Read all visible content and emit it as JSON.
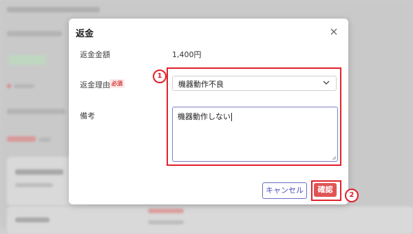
{
  "dialog": {
    "title": "返金",
    "refund_amount_label": "返金金額",
    "refund_amount_value": "1,400円",
    "reason_label": "返金理由",
    "required_badge": "必須",
    "reason_selected": "機器動作不良",
    "notes_label": "備考",
    "notes_value": "機器動作しない",
    "cancel_label": "キャンセル",
    "confirm_label": "確認"
  },
  "annotations": {
    "marker_1": "1",
    "marker_2": "2"
  },
  "colors": {
    "highlight": "#e0202a",
    "confirm_bg": "#e05454",
    "cancel_border": "#6c6cc7"
  },
  "icons": [
    "close-icon",
    "chevron-down-icon",
    "resize-grip-icon"
  ]
}
